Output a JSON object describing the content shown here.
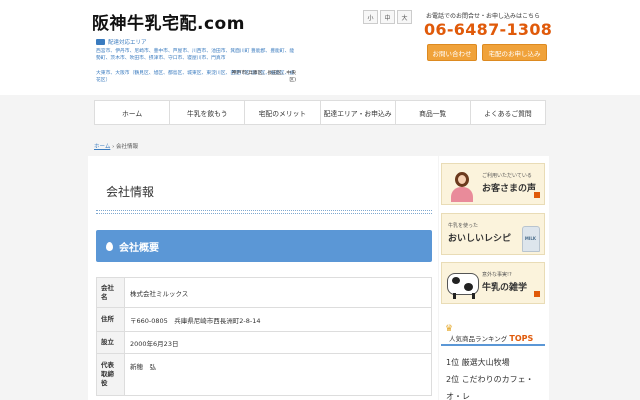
{
  "header": {
    "site_title": "阪神牛乳宅配.com",
    "area_label": "配達対応エリア",
    "area_text": "西宮市、伊丹市、尼崎市、豊中市、芦屋市、川西市、池田市、箕面川町 豊能郡、豊能町、能勢町、茨木市、吹田市、摂津市、守口市、寝屋川市、門真市",
    "area_text2": "大東市、大阪市（鶴見区、旭区、都島区、城東区、東淀川区、西淀川区 淀川区、福島区、此花区）",
    "area_right": "神戸市(兵庫区、長田区、中央区)",
    "font_sizes": [
      "小",
      "中",
      "大"
    ],
    "tel_caption": "お電話でのお問合せ・お申し込みはこちら",
    "tel_number": "06-6487-1308",
    "cta_contact": "お問い合わせ",
    "cta_apply": "宅配のお申し込み"
  },
  "nav": {
    "items": [
      "ホーム",
      "牛乳を飲もう",
      "宅配のメリット",
      "配達エリア・お申込み",
      "商品一覧",
      "よくあるご質問"
    ]
  },
  "breadcrumb": {
    "home": "ホーム",
    "separator": "›",
    "current": "会社情報"
  },
  "main": {
    "page_title": "会社情報",
    "section_title": "会社概要",
    "table": [
      {
        "label": "会社名",
        "value": "株式会社ミルックス"
      },
      {
        "label": "住所",
        "value": "〒660-0805　兵庫県尼崎市西長洲町2-8-14"
      },
      {
        "label": "設立",
        "value": "2000年6月23日"
      },
      {
        "label": "代表取締役",
        "value": "新穂　弘"
      }
    ]
  },
  "sidebar": {
    "voice_small": "ご利用いただいている",
    "voice_big": "お客さまの声",
    "recipe_small": "牛乳を使った",
    "recipe_big": "おいしいレシピ",
    "milk_label": "MILK",
    "trivia_small": "意外な事実!?",
    "trivia_big": "牛乳の雑学",
    "ranking_title": "人気商品ランキング",
    "ranking_tops": "TOPS",
    "ranking": [
      "1位 厳選大山牧場",
      "2位 こだわりのカフェ・オ・レ"
    ]
  },
  "colors": {
    "accent_blue": "#5b97d6",
    "accent_orange": "#e05a0a",
    "cta_orange": "#f0a23a"
  }
}
